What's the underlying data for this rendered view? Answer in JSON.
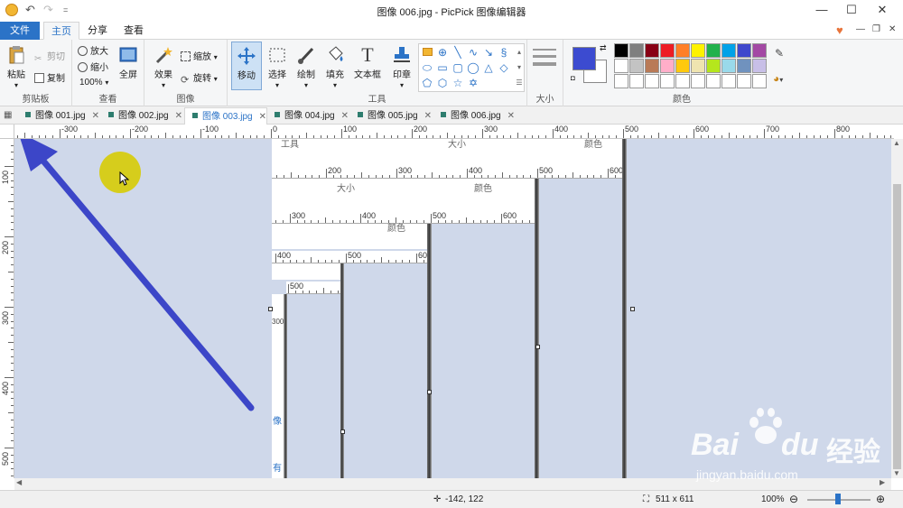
{
  "titlebar": {
    "title": "图像 006.jpg - PicPick 图像编辑器",
    "quick_more": "="
  },
  "ribbon_tabs": [
    "文件",
    "主页",
    "分享",
    "查看"
  ],
  "clipboard": {
    "paste": "粘贴",
    "cut": "剪切",
    "copy": "复制",
    "label": "剪贴板"
  },
  "view": {
    "zoom_in": "放大",
    "zoom_out": "缩小",
    "zoom_level": "100%",
    "fullscreen": "全屏",
    "label": "查看"
  },
  "image": {
    "effects": "效果",
    "resize": "缩放",
    "rotate": "旋转",
    "label": "图像"
  },
  "tools": {
    "move": "移动",
    "select": "选择",
    "draw": "绘制",
    "fill": "填充",
    "textbox": "文本框",
    "stamp": "印章",
    "label": "工具"
  },
  "size": {
    "label": "大小"
  },
  "colors": {
    "label": "颜色",
    "primary": "#3c4bd0",
    "secondary": "#ffffff",
    "palette": [
      "#000000",
      "#7f7f7f",
      "#880015",
      "#ed1c24",
      "#ff7f27",
      "#fff200",
      "#22b14c",
      "#00a2e8",
      "#3f48cc",
      "#a349a4",
      "#ffffff",
      "#c3c3c3",
      "#b97a57",
      "#ffaec9",
      "#ffc90e",
      "#efe4b0",
      "#b5e61d",
      "#99d9ea",
      "#7092be",
      "#c8bfe7",
      "#ffffff",
      "#ffffff",
      "#ffffff",
      "#ffffff",
      "#ffffff",
      "#ffffff",
      "#ffffff",
      "#ffffff",
      "#ffffff",
      "#ffffff"
    ]
  },
  "doc_tabs": [
    "图像 001.jpg",
    "图像 002.jpg",
    "图像 003.jpg",
    "图像 004.jpg",
    "图像 005.jpg",
    "图像 006.jpg"
  ],
  "h_ruler_labels": [
    "-300",
    "-200",
    "-100",
    "0",
    "100",
    "200",
    "300",
    "400",
    "500",
    "600",
    "700",
    "800"
  ],
  "v_ruler_labels": [
    "100",
    "200",
    "300",
    "400",
    "500"
  ],
  "nested": {
    "l1": {
      "labels": [
        "工具",
        "大小",
        "颜色"
      ],
      "ruler": [
        "200",
        "300",
        "400",
        "500",
        "600"
      ]
    },
    "l2": {
      "labels": [
        "大小",
        "颜色"
      ],
      "ruler": [
        "300",
        "400",
        "500",
        "600"
      ]
    },
    "l3": {
      "labels": [
        "颜色"
      ],
      "ruler": [
        "400",
        "500",
        "600"
      ]
    },
    "l4": {
      "ruler": [
        "500"
      ]
    },
    "l5": {
      "ruler": [
        "300"
      ],
      "side_text": [
        "像",
        "有"
      ]
    }
  },
  "statusbar": {
    "cursor": "-142, 122",
    "image_size": "511 x 611",
    "zoom": "100%"
  },
  "watermark": {
    "brand": "Bai",
    "brand2": "du",
    "cn": "经验",
    "url": "jingyan.baidu.com"
  }
}
